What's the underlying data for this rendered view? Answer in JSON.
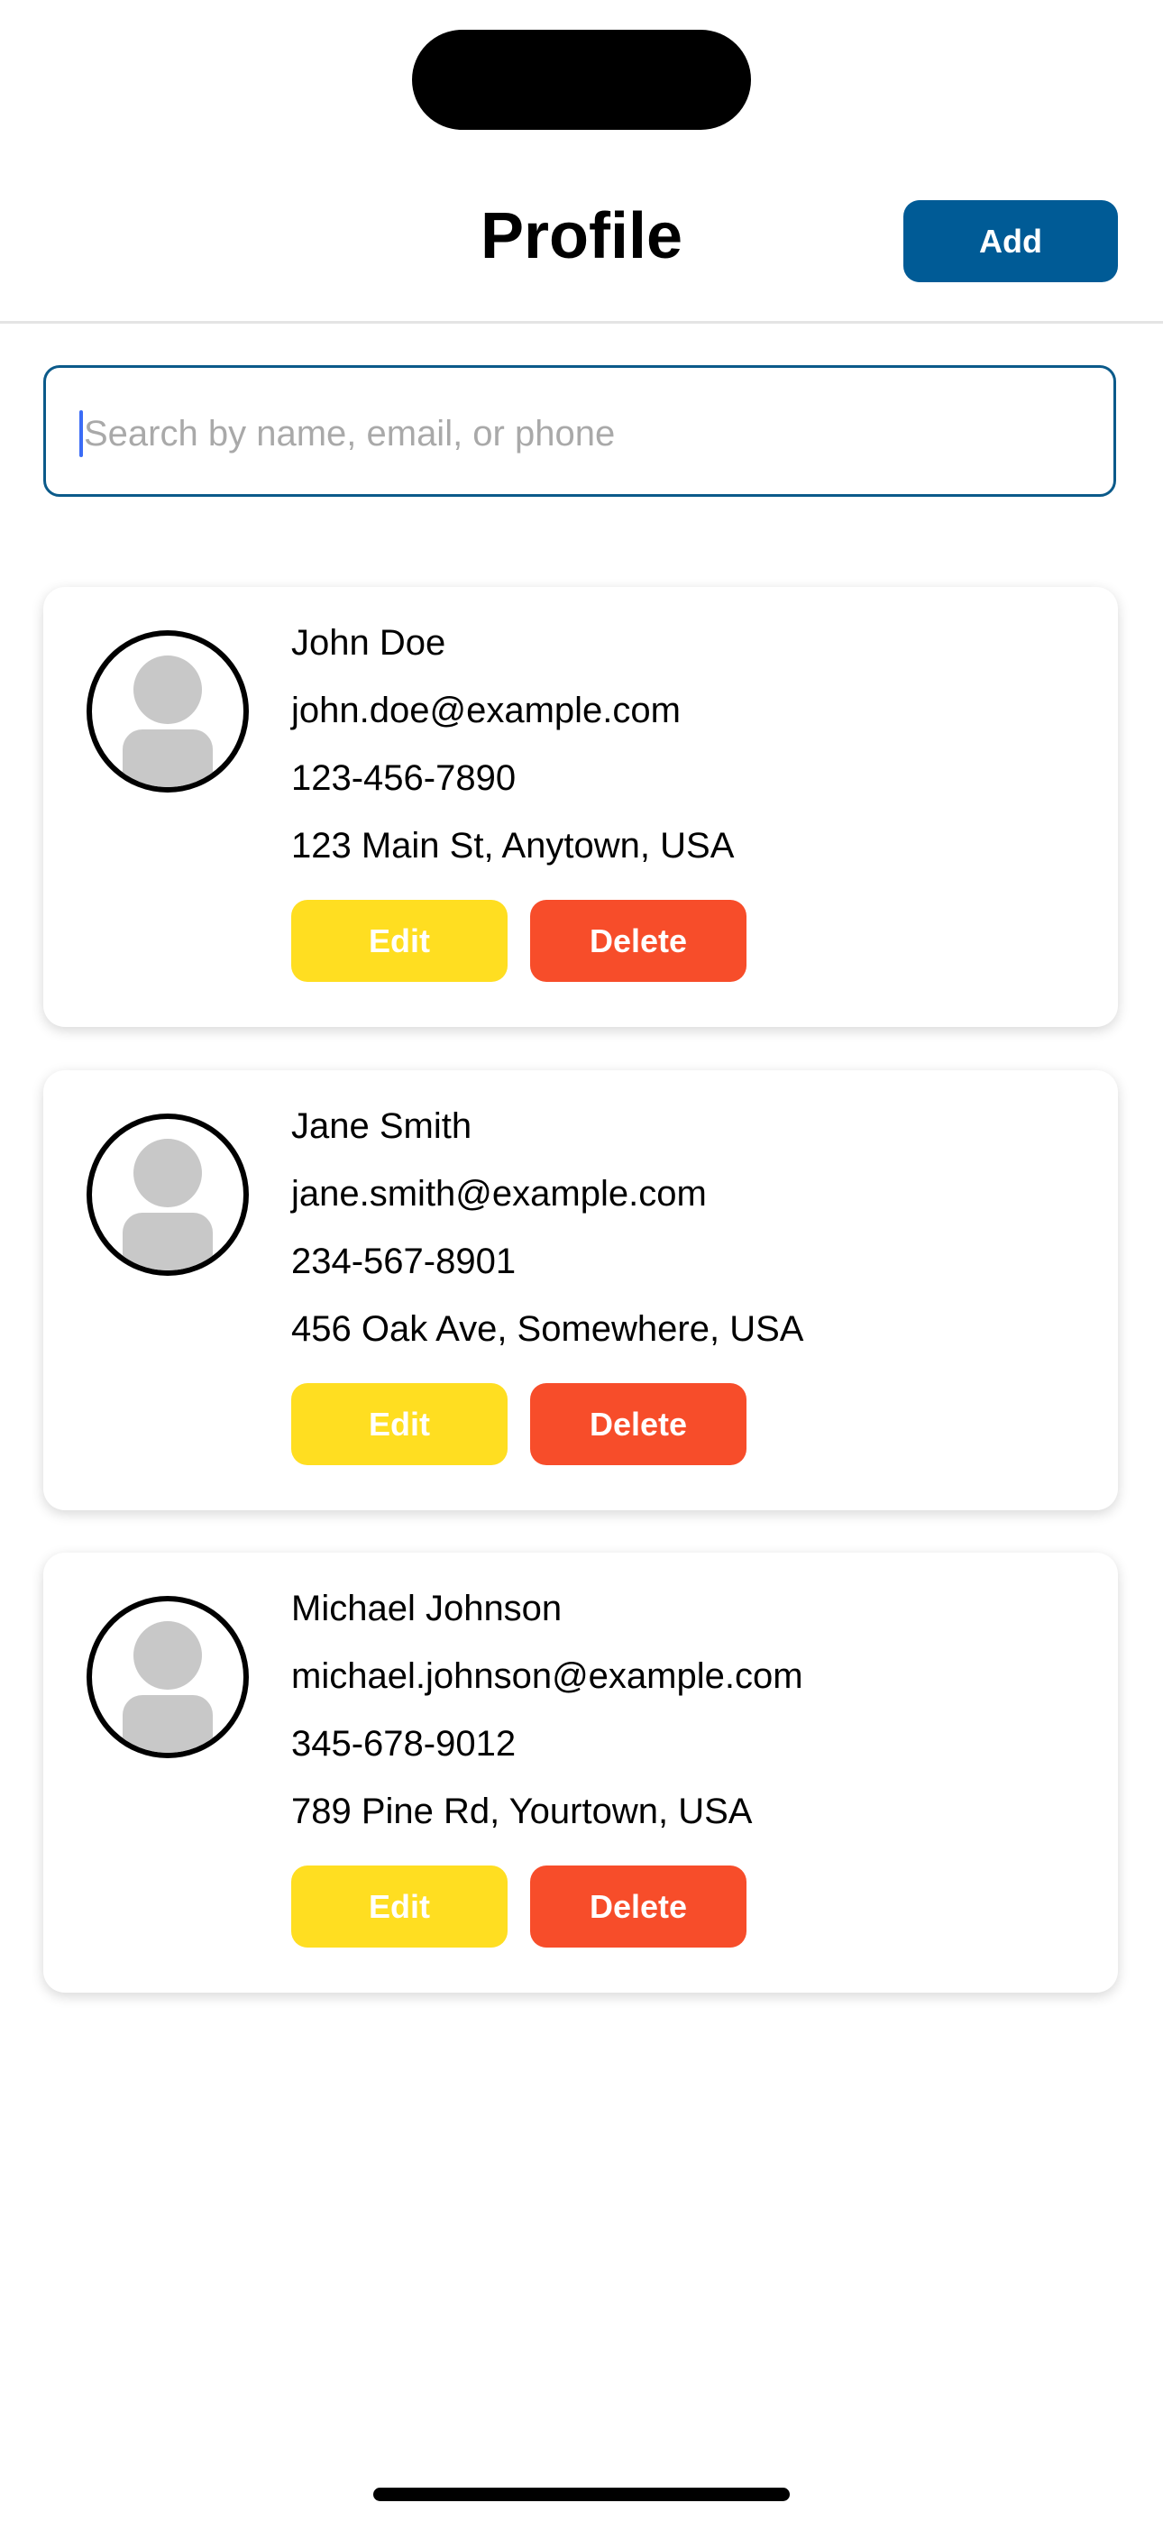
{
  "header": {
    "title": "Profile",
    "add_label": "Add"
  },
  "search": {
    "placeholder": "Search by name, email, or phone",
    "value": ""
  },
  "profiles": [
    {
      "name": "John Doe",
      "email": "john.doe@example.com",
      "phone": "123-456-7890",
      "address": "123 Main St, Anytown, USA",
      "edit_label": "Edit",
      "delete_label": "Delete"
    },
    {
      "name": "Jane Smith",
      "email": "jane.smith@example.com",
      "phone": "234-567-8901",
      "address": "456 Oak Ave, Somewhere, USA",
      "edit_label": "Edit",
      "delete_label": "Delete"
    },
    {
      "name": "Michael Johnson",
      "email": "michael.johnson@example.com",
      "phone": "345-678-9012",
      "address": "789 Pine Rd, Yourtown, USA",
      "edit_label": "Edit",
      "delete_label": "Delete"
    }
  ],
  "icons": {
    "avatar": "default-avatar-icon"
  },
  "colors": {
    "accent": "#005b96",
    "edit": "#ffde21",
    "delete": "#f74d2a",
    "search_border": "#0b5a8a",
    "placeholder": "#a9a9a9"
  }
}
